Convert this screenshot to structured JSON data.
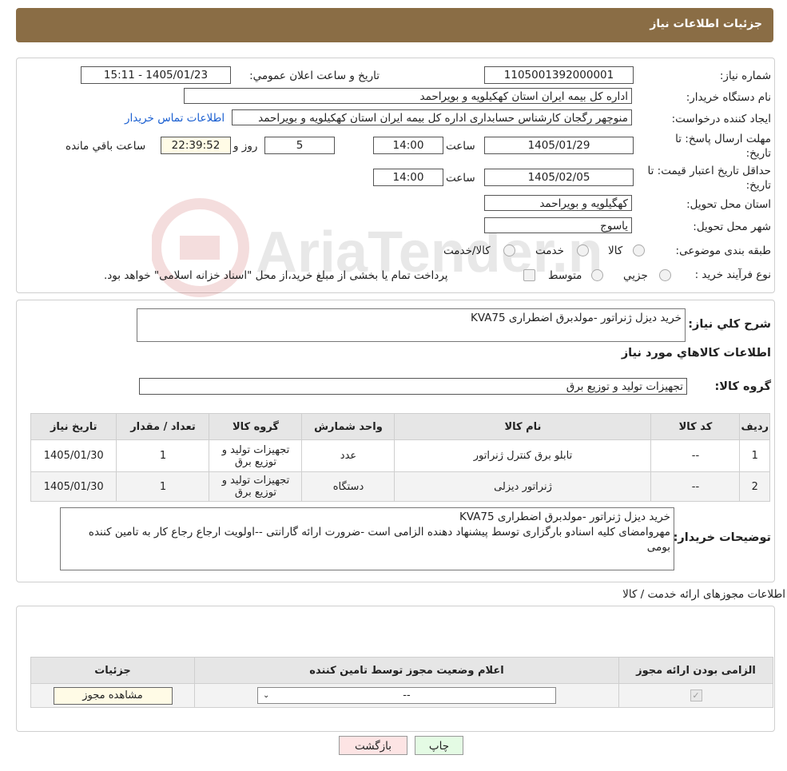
{
  "header": {
    "title": "جزئیات اطلاعات نیاز"
  },
  "watermark": {
    "text": "AriaTender.neT"
  },
  "form": {
    "need_number_label": "شماره نیاز:",
    "need_number": "1105001392000001",
    "announce_label": "تاریخ و ساعت اعلان عمومي:",
    "announce_value": "1405/01/23 - 15:11",
    "buyer_org_label": "نام دستگاه خريدار:",
    "buyer_org": "اداره کل بیمه ایران استان کهکیلویه و بویراحمد",
    "creator_label": "ايجاد کننده درخواست:",
    "creator": "منوچهر رگجان کارشناس حسابداری اداره کل بیمه ایران استان کهکیلویه و بویراحمد",
    "contact_link": "اطلاعات تماس خریدار",
    "deadline_label_1": "مهلت ارسال پاسخ: تا",
    "deadline_label_2": "تاریخ:",
    "deadline_date": "1405/01/29",
    "time_label": "ساعت",
    "deadline_time": "14:00",
    "days_value": "5",
    "days_label": "روز و",
    "remaining_value": "22:39:52",
    "remaining_label": "ساعت باقي مانده",
    "validity_label_1": "حداقل تاريخ اعتبار قيمت: تا",
    "validity_label_2": "تاريخ:",
    "validity_date": "1405/02/05",
    "validity_time": "14:00",
    "province_label": "استان محل تحويل:",
    "province": "کهگیلویه و بویراحمد",
    "city_label": "شهر محل تحويل:",
    "city": "یاسوج",
    "category_label": "طبقه بندی موضوعی:",
    "category_options": [
      "کالا",
      "خدمت",
      "کالا/خدمت"
    ],
    "process_label": "نوع فرآيند خريد :",
    "process_options": [
      "جزيي",
      "متوسط"
    ],
    "process_note": "پرداخت تمام یا بخشی از مبلغ خرید،از محل \"اسناد خزانه اسلامی\" خواهد بود."
  },
  "summary": {
    "label": "شرح کلي نياز:",
    "value": "خرید دیزل ژنراتور -مولدبرق اضطراری KVA75",
    "goods_title": "اطلاعات کالاهاي مورد نياز",
    "group_label": "گروه کالا:",
    "group_value": "تجهیزات تولید و توزیع برق"
  },
  "table": {
    "headers": [
      "رديف",
      "کد کالا",
      "نام کالا",
      "واحد شمارش",
      "گروه کالا",
      "تعداد / مقدار",
      "تاريخ نياز"
    ],
    "rows": [
      [
        "1",
        "--",
        "تابلو برق کنترل ژنراتور",
        "عدد",
        "تجهیزات تولید و توزیع برق",
        "1",
        "1405/01/30"
      ],
      [
        "2",
        "--",
        "ژنراتور دیزلی",
        "دستگاه",
        "تجهیزات تولید و توزیع برق",
        "1",
        "1405/01/30"
      ]
    ]
  },
  "buyer_notes": {
    "label": "توضيحات خريدار:",
    "line1": "خرید دیزل ژنراتور -مولدبرق اضطراری KVA75",
    "line2": "مهروامضای کلیه اسنادو بارگزاری  توسط پیشنهاد دهنده الزامی است -ضرورت ارائه گارانتی --اولویت ارجاع رجاع کار به تامین کننده بومی"
  },
  "permits": {
    "title": "اطلاعات مجوزهای ارائه خدمت / کالا",
    "headers": [
      "الزامی بودن ارائه مجوز",
      "اعلام وضعیت مجوز توسط تامین کننده",
      "جزئیات"
    ],
    "select_value": "--",
    "view_button": "مشاهده مجوز"
  },
  "buttons": {
    "print": "چاپ",
    "back": "بازگشت"
  },
  "colors": {
    "header_bg": "#8a6d45",
    "link": "#1a5fd1",
    "back_bg": "#fde4e4",
    "print_bg": "#e4fbe4"
  }
}
